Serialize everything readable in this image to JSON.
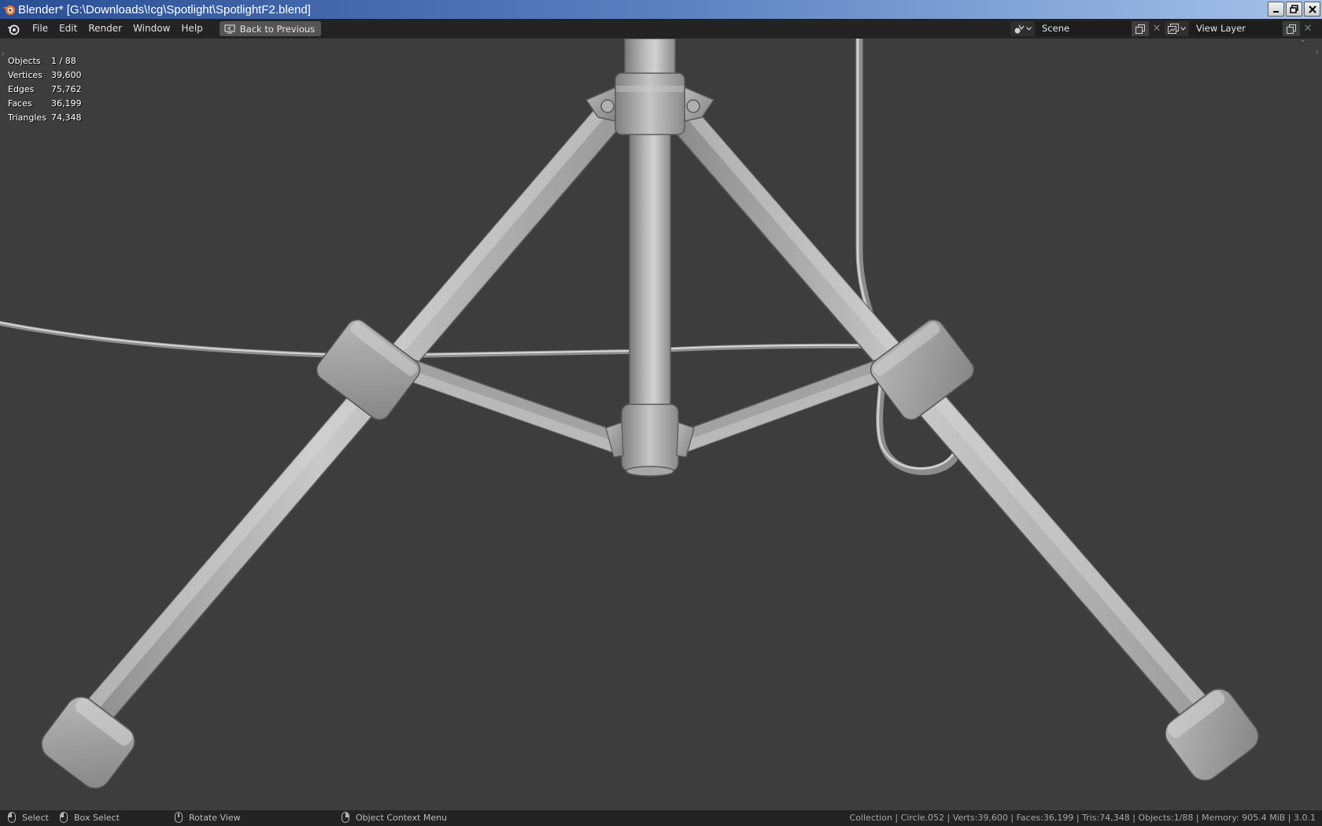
{
  "window": {
    "title": "Blender* [G:\\Downloads\\!cg\\Spotlight\\SpotlightF2.blend]"
  },
  "menu": {
    "items": [
      {
        "label": "File"
      },
      {
        "label": "Edit"
      },
      {
        "label": "Render"
      },
      {
        "label": "Window"
      },
      {
        "label": "Help"
      }
    ],
    "back_button": "Back to Previous"
  },
  "scene_selector": {
    "value": "Scene",
    "icon": "scene-icon"
  },
  "view_layer_selector": {
    "value": "View Layer",
    "icon": "view-layer-icon"
  },
  "stats": [
    {
      "label": "Objects",
      "value": "1 / 88"
    },
    {
      "label": "Vertices",
      "value": "39,600"
    },
    {
      "label": "Edges",
      "value": "75,762"
    },
    {
      "label": "Faces",
      "value": "36,199"
    },
    {
      "label": "Triangles",
      "value": "74,348"
    }
  ],
  "statusbar": {
    "select": "Select",
    "box_select": "Box Select",
    "rotate_view": "Rotate View",
    "context_menu": "Object Context Menu",
    "info": "Collection | Circle.052 | Verts:39,600 | Faces:36,199 | Tris:74,348 | Objects:1/88 | Memory: 905.4 MiB | 3.0.1"
  },
  "colors": {
    "viewport_bg": "#3d3d3d",
    "header_bg": "#232323",
    "mesh_light": "#c4c4c4",
    "mesh_mid": "#9e9e9e",
    "mesh_dark": "#6e6e6e"
  }
}
